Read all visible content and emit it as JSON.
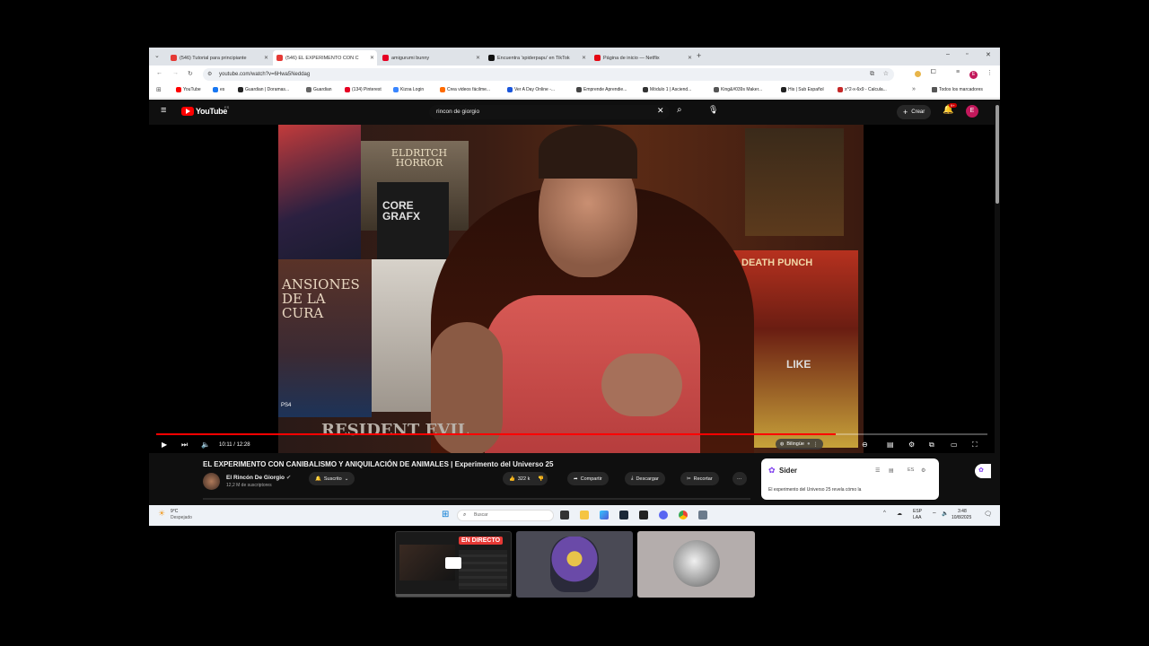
{
  "browser": {
    "tabs": [
      {
        "label": "(546) Tutorial para principiante",
        "color": "#e53935"
      },
      {
        "label": "(546) EL EXPERIMENTO CON C",
        "color": "#e53935",
        "active": true
      },
      {
        "label": "amigurumi bunny",
        "color": "#e60023"
      },
      {
        "label": "Encuentra 'spiderpapu' en TikTok",
        "color": "#111111"
      },
      {
        "label": "Página de inicio — Netflix",
        "color": "#e50914"
      }
    ],
    "new_tab": "+",
    "url": "youtube.com/watch?v=6Hwa5Neddag",
    "bookmarks": [
      {
        "label": "YouTube",
        "color": "#ff0000"
      },
      {
        "label": "es",
        "color": "#1877f2"
      },
      {
        "label": "Guardian | Doramas...",
        "color": "#222222"
      },
      {
        "label": "Guardian",
        "color": "#666666"
      },
      {
        "label": "(134) Pinterest",
        "color": "#e60023"
      },
      {
        "label": "Kizoa Login",
        "color": "#3a86ff"
      },
      {
        "label": "Crea videos fácilme...",
        "color": "#ff6b00"
      },
      {
        "label": "Ver A Day Online -...",
        "color": "#1a56db"
      },
      {
        "label": "Emprende Aprendie...",
        "color": "#444444"
      },
      {
        "label": "Módulo 1 | Asciend...",
        "color": "#333333"
      },
      {
        "label": "King&#039s Maker...",
        "color": "#555555"
      },
      {
        "label": "His | Sub Español",
        "color": "#222222"
      },
      {
        "label": "x^2-x-6x9 - Calcula...",
        "color": "#c62828"
      }
    ],
    "all_bookmarks": "Todos los marcadores"
  },
  "youtube": {
    "logo": "YouTube",
    "logo_suffix": "ES",
    "search_value": "rincon de giorgio",
    "create_label": "Crear",
    "notif_count": "9+",
    "avatar_letter": "E",
    "video": {
      "time_current": "10:11",
      "time_total": "12:28",
      "progress_fraction": 0.817,
      "audio_track": "Bilingüe",
      "overlay_texts": [
        "ELDRITCH HORROR",
        "CORE GRAFX",
        "PS4",
        "RESIDENT EVIL",
        "DEATH PUNCH",
        "ANSIONES DE LA CURA",
        "LIKE"
      ]
    },
    "title": "EL EXPERIMENTO CON CANIBALISMO Y ANIQUILACIÓN DE ANIMALES | Experimento del Universo 25",
    "channel": "El Rincón De Giorgio",
    "subscribers": "12,2 M de suscriptores",
    "subscribe_label": "Suscrito",
    "likes": "322 k",
    "share_label": "Compartir",
    "download_label": "Descargar",
    "clip_label": "Recortar",
    "sider": {
      "title": "Sider",
      "lang": "ES",
      "text": "El experimento del Universo 25 revela cómo la"
    }
  },
  "taskbar": {
    "weather_temp": "9°C",
    "weather_desc": "Despejado",
    "search_placeholder": "Buscar",
    "lang": "ESP",
    "lang2": "LAA",
    "time": "3:48",
    "date": "10/8/2025"
  },
  "thumbnails": {
    "live_badge": "EN DIRECTO"
  },
  "colors": {
    "youtube_red": "#ff0000",
    "taskbar_bg": "#eef2f7",
    "chrome_tabs_bg": "#dfe3e8"
  }
}
